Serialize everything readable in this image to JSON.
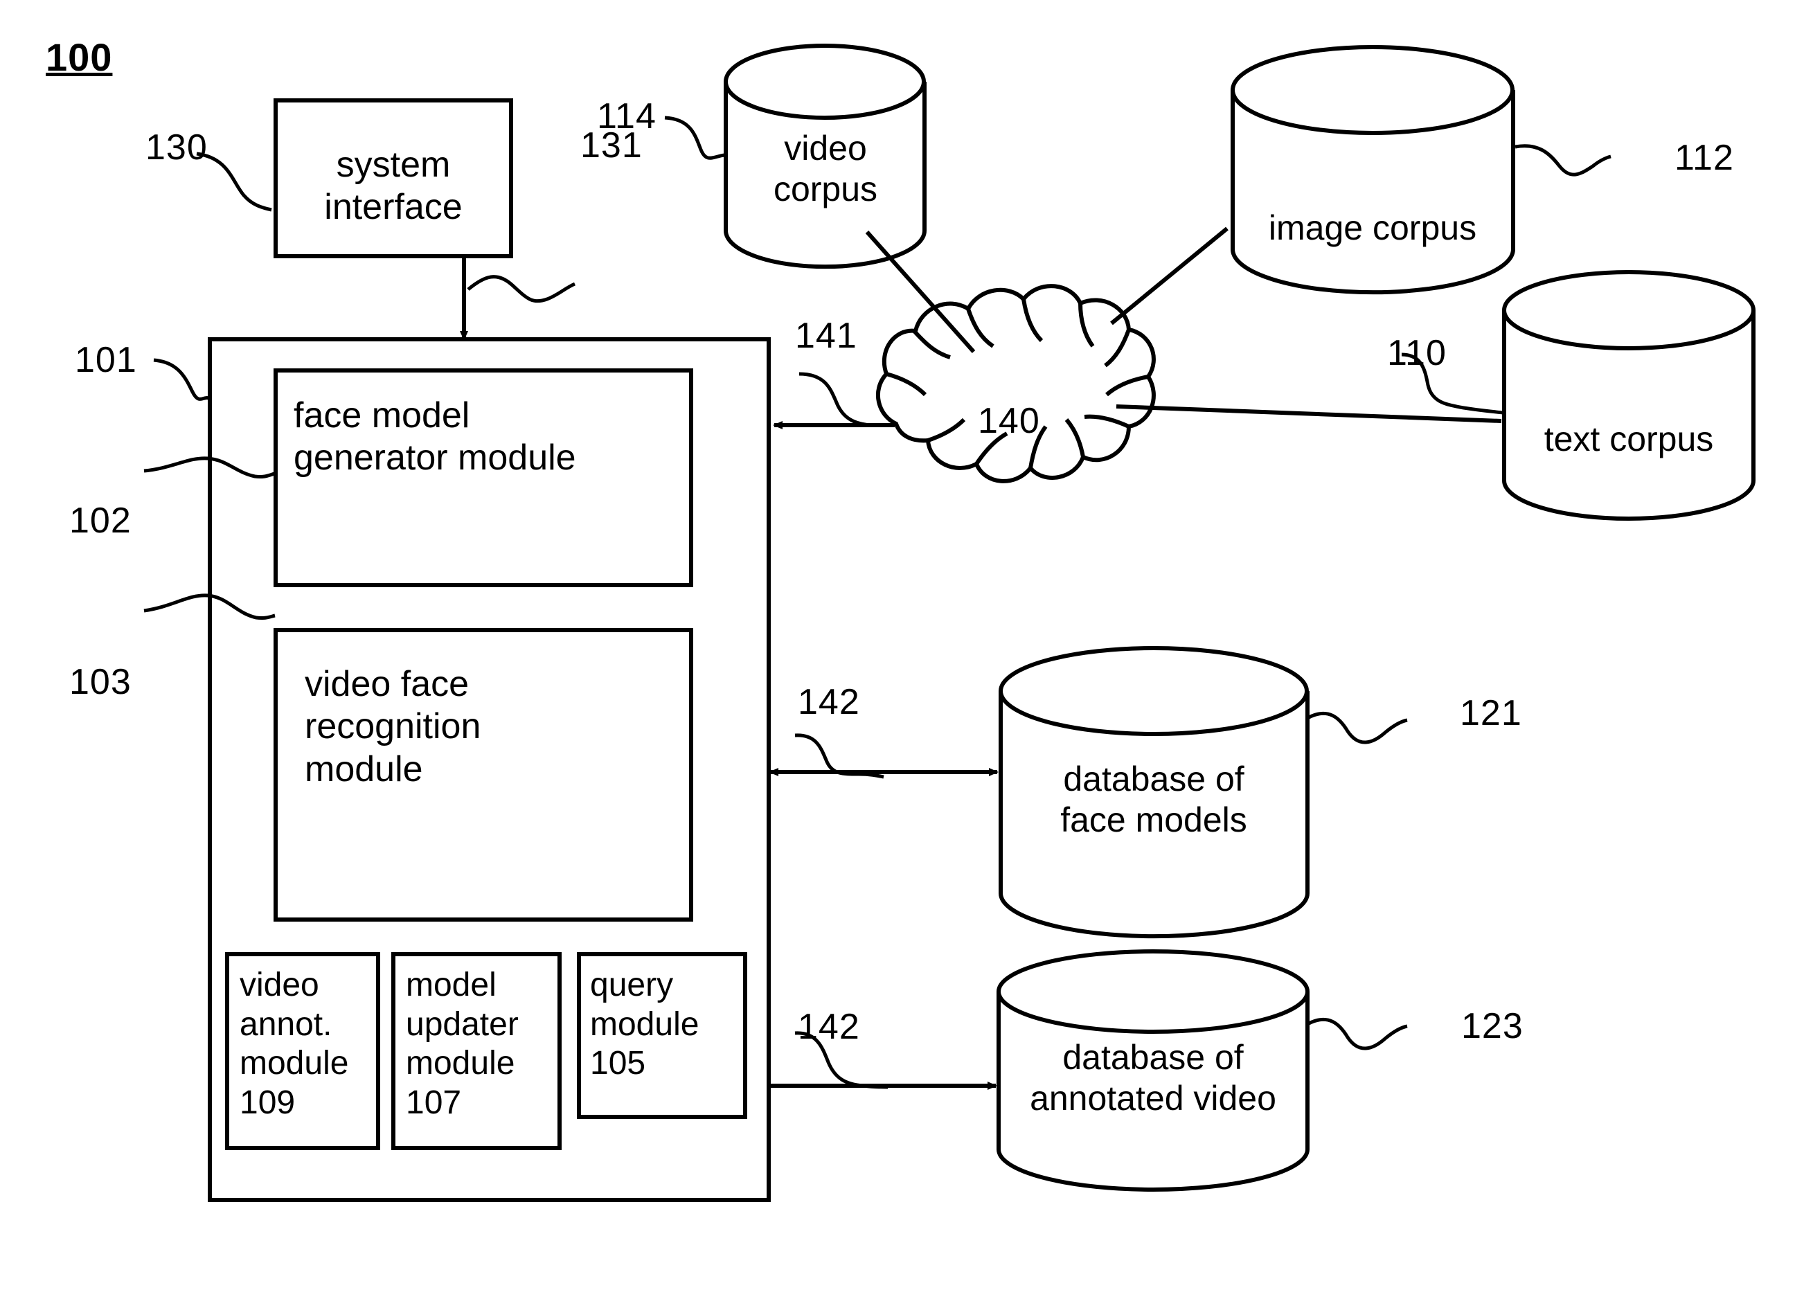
{
  "figure": {
    "number": "100"
  },
  "blocks": {
    "system_interface": {
      "label": "system\ninterface",
      "ref": "130"
    },
    "recognition_system": {
      "ref": "101"
    },
    "face_model_generator": {
      "label": "face model\ngenerator module",
      "ref": "102"
    },
    "video_face_recognition": {
      "label": "video face\nrecognition\nmodule",
      "ref": "103"
    },
    "video_annot_module": {
      "label": "video\nannot.\nmodule\n109"
    },
    "model_updater_module": {
      "label": "model\nupdater\nmodule\n107"
    },
    "query_module": {
      "label": "query\nmodule\n105"
    }
  },
  "stores": {
    "video_corpus": {
      "label": "video\ncorpus",
      "ref": "114"
    },
    "image_corpus": {
      "label": "image corpus",
      "ref": "112"
    },
    "text_corpus": {
      "label": "text corpus",
      "ref": "110"
    },
    "face_models_db": {
      "label": "database of\nface models",
      "ref": "121"
    },
    "annotated_video_db": {
      "label": "database of\nannotated video",
      "ref": "123"
    }
  },
  "network": {
    "cloud_label": "140",
    "link_to_system": "141"
  },
  "connectors": {
    "interface_to_system": "131",
    "system_to_face_models": "142",
    "system_to_annotated_video": "142"
  },
  "style": {
    "stroke": "#000000",
    "background": "#ffffff"
  }
}
